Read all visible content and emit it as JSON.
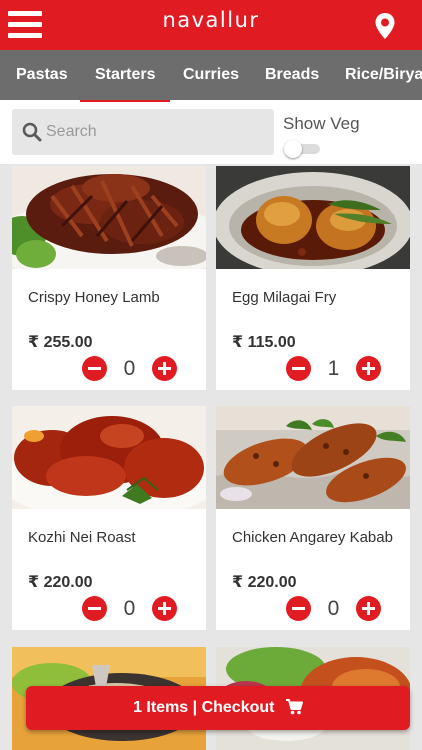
{
  "app": {
    "brand": "navallur"
  },
  "header": {
    "menu_icon": "hamburger-menu-icon",
    "location_icon": "map-pin-icon"
  },
  "categories": [
    "Pastas",
    "Starters",
    "Curries",
    "Breads",
    "Rice/Biryani"
  ],
  "search": {
    "placeholder": "Search",
    "value": "",
    "veg_label": "Show Veg",
    "veg_on": false
  },
  "items": [
    {
      "name": "Crispy Honey Lamb",
      "price": "₹ 255.00",
      "qty": "0"
    },
    {
      "name": "Egg Milagai Fry",
      "price": "₹ 115.00",
      "qty": "1"
    },
    {
      "name": "Kozhi Nei Roast",
      "price": "₹ 220.00",
      "qty": "0"
    },
    {
      "name": "Chicken Angarey Kabab",
      "price": "₹ 220.00",
      "qty": "0"
    }
  ],
  "checkout": {
    "label": "1 Items | Checkout",
    "icon": "cart-icon"
  },
  "colors": {
    "brand": "#e11b22",
    "category_bar": "#6d6d6d",
    "background": "#e6e6e6"
  }
}
